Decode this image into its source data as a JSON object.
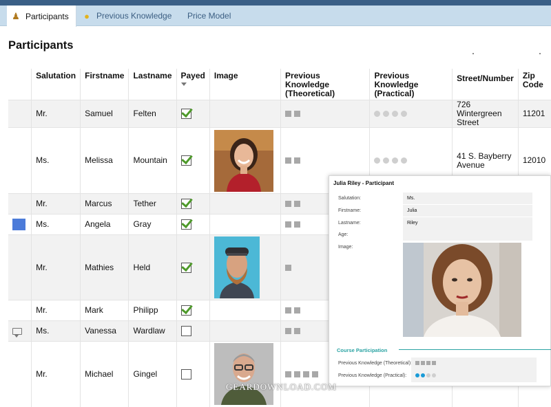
{
  "tabs": [
    {
      "label": "Participants",
      "icon": "people-icon",
      "active": true
    },
    {
      "label": "Previous Knowledge",
      "icon": "lightbulb-icon",
      "active": false
    },
    {
      "label": "Price Model",
      "icon": "",
      "active": false
    }
  ],
  "page_title": "Participants",
  "table": {
    "headers": {
      "salutation": "Salutation",
      "firstname": "Firstname",
      "lastname": "Lastname",
      "payed": "Payed",
      "image": "Image",
      "prev_theoretical": "Previous Knowledge (Theoretical)",
      "prev_practical": "Previous Knowledge (Practical)",
      "street": "Street/Number",
      "zip": "Zip Code"
    },
    "rows": [
      {
        "salutation": "Mr.",
        "firstname": "Samuel",
        "lastname": "Felten",
        "payed": true,
        "street": "726 Wintergreen Street",
        "zip": "11201",
        "theoretical_level": 2,
        "practical_level": 4
      },
      {
        "salutation": "Ms.",
        "firstname": "Melissa",
        "lastname": "Mountain",
        "payed": true,
        "street": "41 S. Bayberry Avenue",
        "zip": "12010",
        "theoretical_level": 2,
        "practical_level": 4
      },
      {
        "salutation": "Mr.",
        "firstname": "Marcus",
        "lastname": "Tether",
        "payed": true,
        "theoretical_level": 2
      },
      {
        "salutation": "Ms.",
        "firstname": "Angela",
        "lastname": "Gray",
        "payed": true,
        "theoretical_level": 2
      },
      {
        "salutation": "Mr.",
        "firstname": "Mathies",
        "lastname": "Held",
        "payed": true,
        "theoretical_level": 1
      },
      {
        "salutation": "Mr.",
        "firstname": "Mark",
        "lastname": "Philipp",
        "payed": true,
        "theoretical_level": 2
      },
      {
        "salutation": "Ms.",
        "firstname": "Vanessa",
        "lastname": "Wardlaw",
        "payed": false,
        "theoretical_level": 2
      },
      {
        "salutation": "Mr.",
        "firstname": "Michael",
        "lastname": "Gingel",
        "payed": false,
        "theoretical_level": 4
      }
    ]
  },
  "detail": {
    "title": "Julia Riley - Participant",
    "fields": [
      {
        "label": "Salutation:",
        "value": "Ms."
      },
      {
        "label": "Firstname:",
        "value": "Julia"
      },
      {
        "label": "Lastname:",
        "value": "Riley"
      },
      {
        "label": "Age:",
        "value": ""
      },
      {
        "label": "Image:",
        "value": ""
      }
    ],
    "section_title": "Course Participation",
    "theoretical_label": "Previous Knowledge (Theoretical):",
    "practical_label": "Previous Knowledge (Practical):",
    "theoretical_level": 4,
    "practical_level": 2,
    "practical_max": 4
  },
  "watermark": "GEARDOWNLOAD.COM",
  "colors": {
    "tab_bar": "#c7dcec",
    "check_green": "#4e9a2a",
    "selection_blue": "#4c7bd9",
    "accent_teal": "#2aa3a3",
    "circle_active": "#1a9bd7"
  }
}
